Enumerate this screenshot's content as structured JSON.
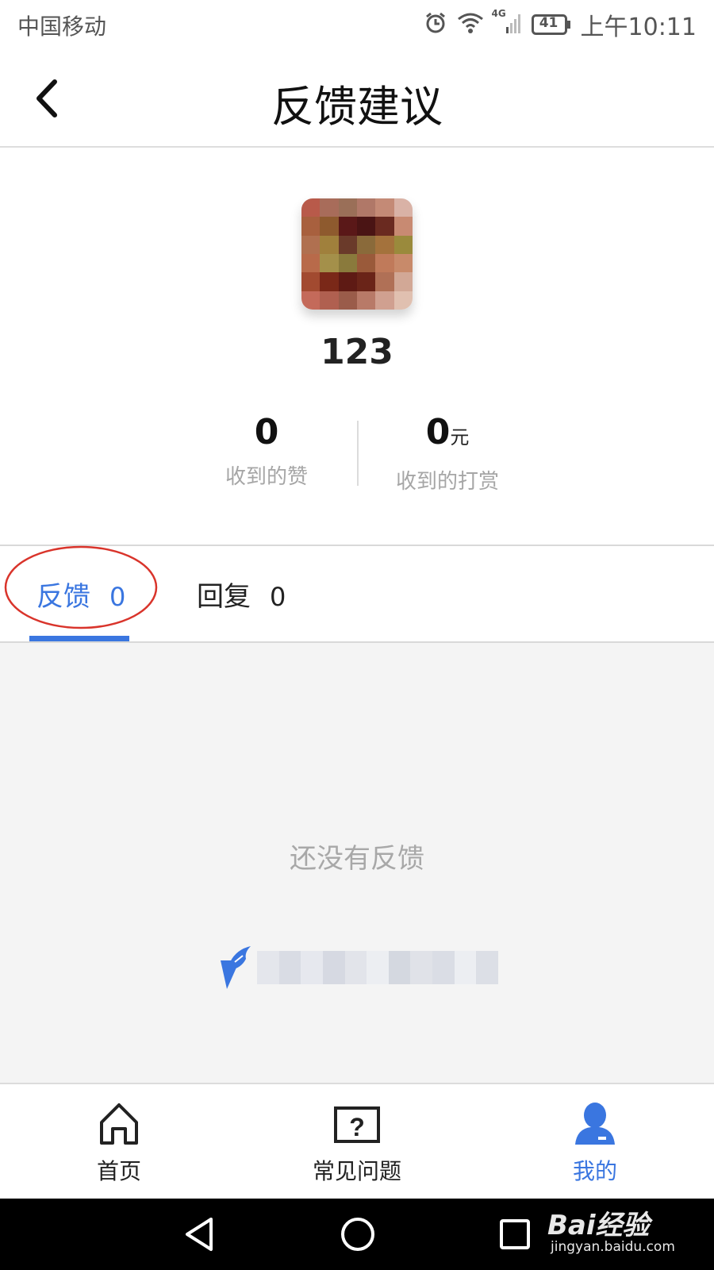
{
  "status_bar": {
    "carrier": "中国移动",
    "network": "4G",
    "battery": "41",
    "time": "上午10:11"
  },
  "header": {
    "title": "反馈建议"
  },
  "profile": {
    "username": "123",
    "likes": {
      "value": "0",
      "label": "收到的赞"
    },
    "rewards": {
      "value": "0",
      "unit": "元",
      "label": "收到的打赏"
    }
  },
  "tabs": [
    {
      "label": "反馈",
      "count": "0",
      "active": true
    },
    {
      "label": "回复",
      "count": "0",
      "active": false
    }
  ],
  "content": {
    "empty_text": "还没有反馈"
  },
  "bottom_nav": [
    {
      "label": "首页",
      "icon": "home-icon"
    },
    {
      "label": "常见问题",
      "icon": "question-icon"
    },
    {
      "label": "我的",
      "icon": "user-icon",
      "active": true
    }
  ],
  "watermark": {
    "top": "Bai经验",
    "bottom": "jingyan.baidu.com"
  },
  "colors": {
    "accent": "#3a76e0",
    "annotation_red": "#d9342b",
    "content_bg": "#f4f4f4"
  }
}
